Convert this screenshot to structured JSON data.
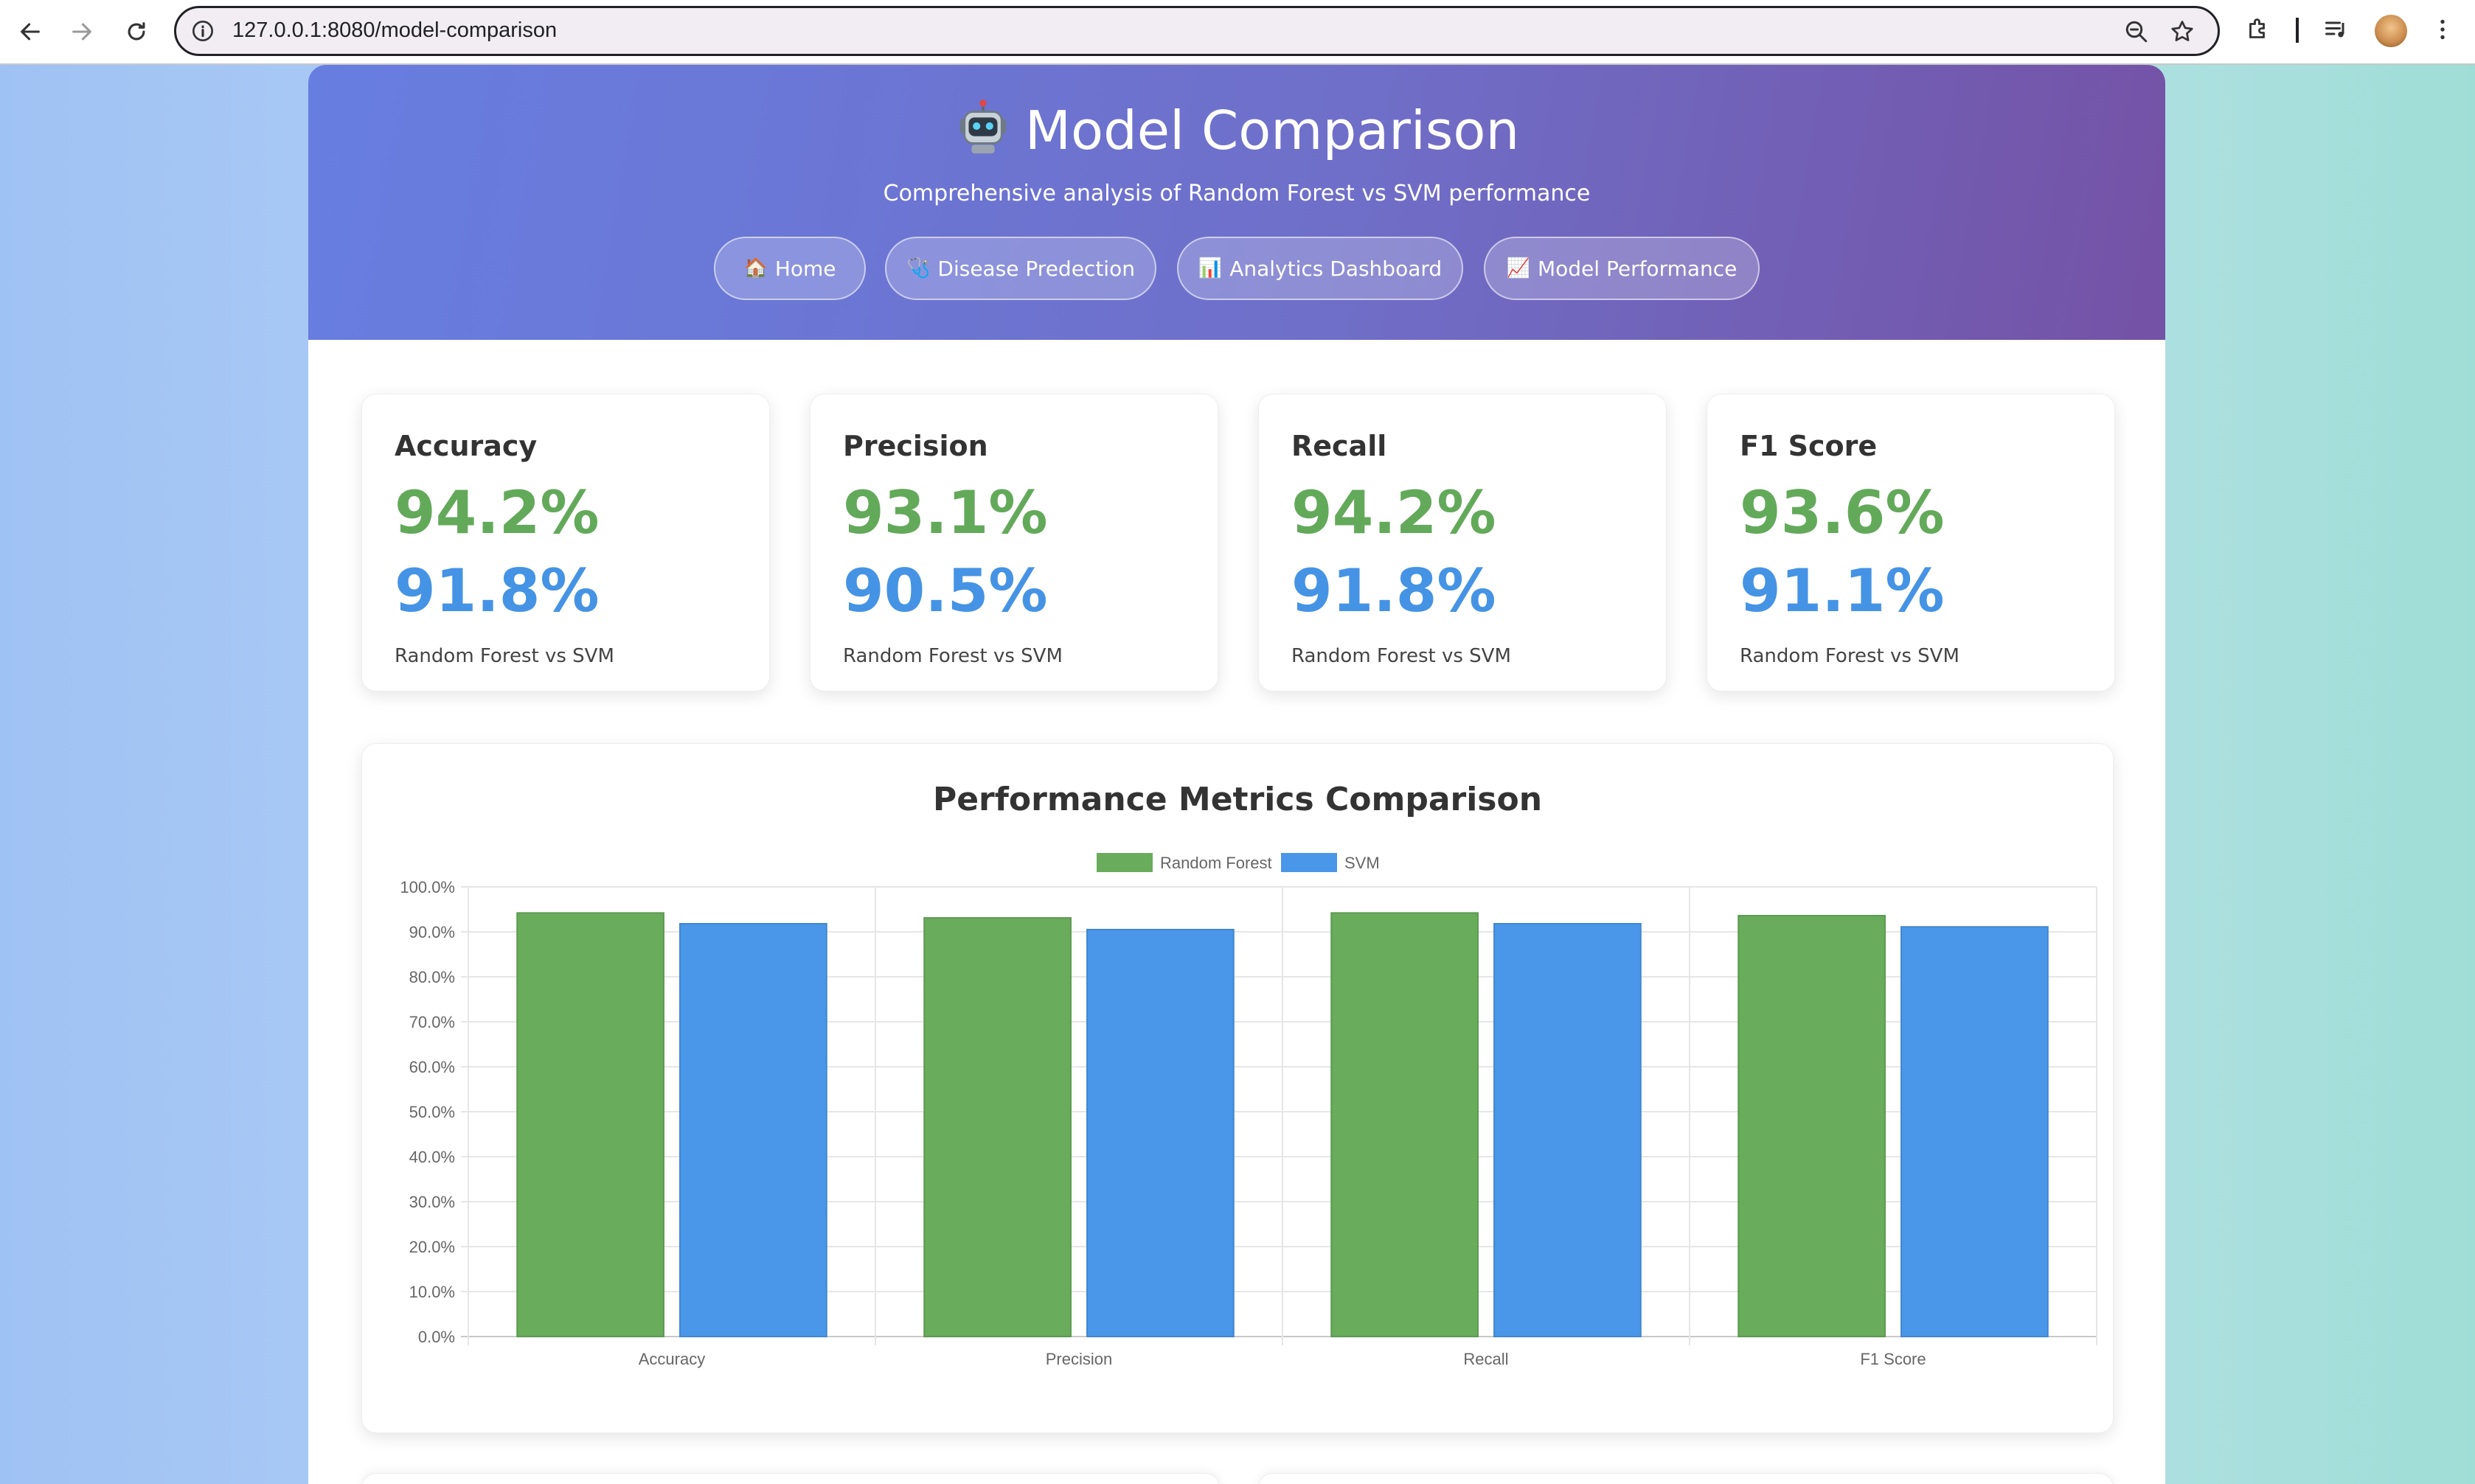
{
  "browser": {
    "url": "127.0.0.1:8080/model-comparison"
  },
  "hero": {
    "title": "Model Comparison",
    "subtitle": "Comprehensive analysis of Random Forest vs SVM performance",
    "nav": [
      {
        "icon": "🏠",
        "label": "Home"
      },
      {
        "icon": "🩺",
        "label": "Disease Predection"
      },
      {
        "icon": "📊",
        "label": "Analytics Dashboard"
      },
      {
        "icon": "📈",
        "label": "Model Performance"
      }
    ]
  },
  "metrics": [
    {
      "title": "Accuracy",
      "rf": "94.2%",
      "svm": "91.8%",
      "foot": "Random Forest vs SVM"
    },
    {
      "title": "Precision",
      "rf": "93.1%",
      "svm": "90.5%",
      "foot": "Random Forest vs SVM"
    },
    {
      "title": "Recall",
      "rf": "94.2%",
      "svm": "91.8%",
      "foot": "Random Forest vs SVM"
    },
    {
      "title": "F1 Score",
      "rf": "93.6%",
      "svm": "91.1%",
      "foot": "Random Forest vs SVM"
    }
  ],
  "colors": {
    "rf": "#68ac5c",
    "svm": "#4a97e9"
  },
  "chart_data": {
    "type": "bar",
    "title": "Performance Metrics Comparison",
    "categories": [
      "Accuracy",
      "Precision",
      "Recall",
      "F1 Score"
    ],
    "series": [
      {
        "name": "Random Forest",
        "values": [
          94.2,
          93.1,
          94.2,
          93.6
        ]
      },
      {
        "name": "SVM",
        "values": [
          91.8,
          90.5,
          91.8,
          91.1
        ]
      }
    ],
    "ylim": [
      0,
      100
    ],
    "yticks": [
      "0.0%",
      "10.0%",
      "20.0%",
      "30.0%",
      "40.0%",
      "50.0%",
      "60.0%",
      "70.0%",
      "80.0%",
      "90.0%",
      "100.0%"
    ],
    "grid": true,
    "legend": "top-center"
  }
}
